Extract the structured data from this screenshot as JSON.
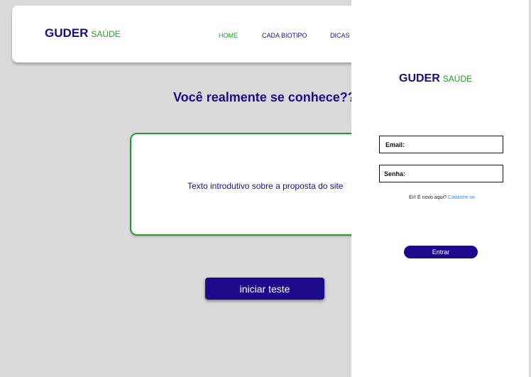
{
  "header": {
    "logo_main": "GUDER",
    "logo_sub": "SAÚDE",
    "nav": [
      "HOME",
      "CADA BIOTIPO",
      "DICAS"
    ]
  },
  "main": {
    "headline": "Você realmente se conhece??",
    "intro_text": "Texto introdutivo sobre a proposta do site",
    "start_button": "iniciar teste"
  },
  "login": {
    "logo_main": "GUDER",
    "logo_sub": "SAÚDE",
    "email_label": "Email:",
    "senha_label": "Senha:",
    "signup_prompt": "Ei!! É novo aqui?",
    "signup_link": "Cadastre-se",
    "enter_button": "Entrar"
  },
  "colors": {
    "primary": "#1b0a8a",
    "accent": "#1f9e2e",
    "background": "#d9d9d9",
    "link": "#3a86ff"
  }
}
